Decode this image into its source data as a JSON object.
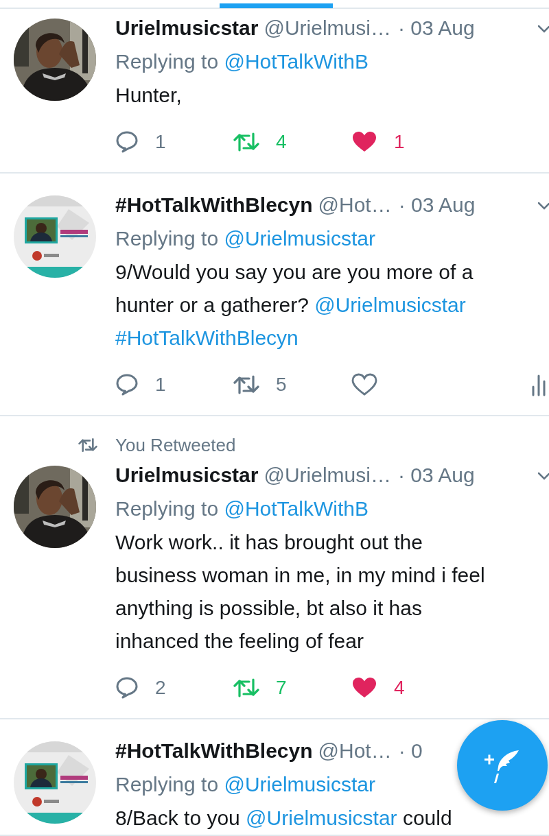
{
  "tweets": [
    {
      "avatar": {
        "kind": "picture"
      },
      "name": "Urielmusicstar",
      "handle": "@Urielmusi…",
      "date": "· 03 Aug",
      "caret": true,
      "reply_to": {
        "label": "Replying to",
        "handle": "@HotTalkWithB"
      },
      "body": [
        [
          {
            "kind": "text",
            "t": "Hunter,"
          }
        ]
      ],
      "actions": {
        "replies": "1",
        "retweets": "4",
        "likes": "1",
        "retweeted": true,
        "liked": true,
        "analytics": false
      }
    },
    {
      "avatar": {
        "kind": "picture"
      },
      "name": "#HotTalkWithBlecyn",
      "handle": "@Hot…",
      "date": "· 03 Aug",
      "caret": true,
      "reply_to": {
        "label": "Replying to",
        "handle": "@Urielmusicstar"
      },
      "body": [
        [
          {
            "kind": "text",
            "t": "9/Would you say you are you more of a"
          }
        ],
        [
          {
            "kind": "text",
            "t": "hunter or a gatherer? "
          },
          {
            "kind": "mention",
            "t": "@Urielmusicstar"
          }
        ],
        [
          {
            "kind": "hashtag",
            "t": "#HotTalkWithBlecyn"
          }
        ]
      ],
      "actions": {
        "replies": "1",
        "retweets": "5",
        "retweeted": false,
        "liked": false,
        "analytics": true
      }
    },
    {
      "retweet_header": "You Retweeted",
      "avatar": {
        "kind": "picture"
      },
      "name": "Urielmusicstar",
      "handle": "@Urielmusi…",
      "date": "· 03 Aug",
      "caret": true,
      "reply_to": {
        "label": "Replying to",
        "handle": "@HotTalkWithB"
      },
      "body": [
        [
          {
            "kind": "text",
            "t": "Work work.. it has brought out the"
          }
        ],
        [
          {
            "kind": "text",
            "t": "business woman in me, in my mind i feel"
          }
        ],
        [
          {
            "kind": "text",
            "t": "anything is possible, bt also it has"
          }
        ],
        [
          {
            "kind": "text",
            "t": "inhanced the feeling of fear"
          }
        ]
      ],
      "actions": {
        "replies": "2",
        "retweets": "7",
        "likes": "4",
        "retweeted": true,
        "liked": true,
        "analytics": false
      }
    },
    {
      "avatar": {
        "kind": "picture"
      },
      "name": "#HotTalkWithBlecyn",
      "handle": "@Hot…",
      "date": "· 0",
      "caret": false,
      "reply_to": {
        "label": "Replying to",
        "handle": "@Urielmusicstar"
      },
      "body": [
        [
          {
            "kind": "text",
            "t": "8/Back to you "
          },
          {
            "kind": "mention",
            "t": "@Urielmusicstar"
          },
          {
            "kind": "text",
            "t": " could"
          }
        ]
      ]
    }
  ]
}
